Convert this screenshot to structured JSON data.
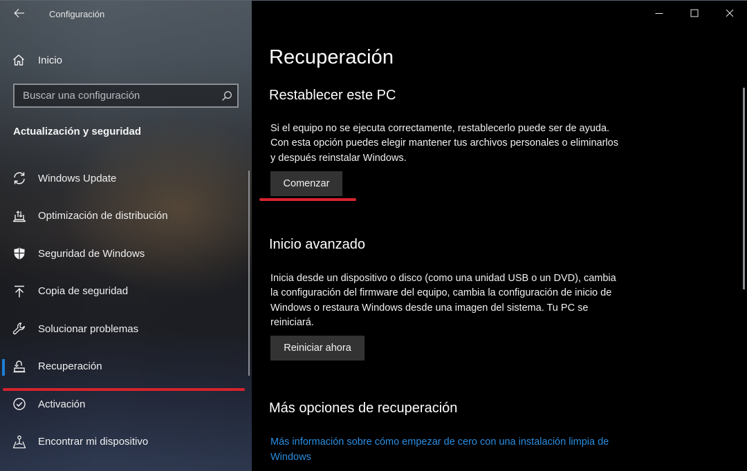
{
  "window": {
    "title": "Configuración",
    "controls": {
      "minimize": "minimize-icon",
      "maximize": "maximize-icon",
      "close": "close-icon"
    }
  },
  "sidebar": {
    "back_icon": "arrow-left-icon",
    "home": {
      "icon": "home-icon",
      "label": "Inicio"
    },
    "search": {
      "placeholder": "Buscar una configuración",
      "value": "",
      "icon": "search-icon"
    },
    "section_title": "Actualización y seguridad",
    "items": [
      {
        "id": "windows-update",
        "label": "Windows Update",
        "icon": "sync-icon",
        "active": false
      },
      {
        "id": "delivery-optimization",
        "label": "Optimización de distribución",
        "icon": "delivery-optimization-icon",
        "active": false
      },
      {
        "id": "windows-security",
        "label": "Seguridad de Windows",
        "icon": "shield-icon",
        "active": false
      },
      {
        "id": "backup",
        "label": "Copia de seguridad",
        "icon": "upload-icon",
        "active": false
      },
      {
        "id": "troubleshoot",
        "label": "Solucionar problemas",
        "icon": "wrench-icon",
        "active": false
      },
      {
        "id": "recovery",
        "label": "Recuperación",
        "icon": "recovery-icon",
        "active": true
      },
      {
        "id": "activation",
        "label": "Activación",
        "icon": "check-circle-icon",
        "active": false
      },
      {
        "id": "find-device",
        "label": "Encontrar mi dispositivo",
        "icon": "find-device-icon",
        "active": false
      }
    ]
  },
  "main": {
    "title": "Recuperación",
    "sections": {
      "reset": {
        "heading": "Restablecer este PC",
        "description": "Si el equipo no se ejecuta correctamente, restablecerlo puede ser de ayuda. Con esta opción puedes elegir mantener tus archivos personales o eliminarlos y después reinstalar Windows.",
        "button": "Comenzar"
      },
      "advanced": {
        "heading": "Inicio avanzado",
        "description": "Inicia desde un dispositivo o disco (como una unidad USB o un DVD), cambia la configuración del firmware del equipo, cambia la configuración de inicio de Windows o restaura Windows desde una imagen del sistema. Tu PC se reiniciará.",
        "button": "Reiniciar ahora"
      },
      "more": {
        "heading": "Más opciones de recuperación",
        "link": "Más información sobre cómo empezar de cero con una instalación limpia de Windows"
      }
    }
  },
  "colors": {
    "accent": "#1d7fd6",
    "link": "#2a8de0",
    "annotation": "#d7232d",
    "button_bg": "#333333",
    "content_bg": "#000000"
  }
}
